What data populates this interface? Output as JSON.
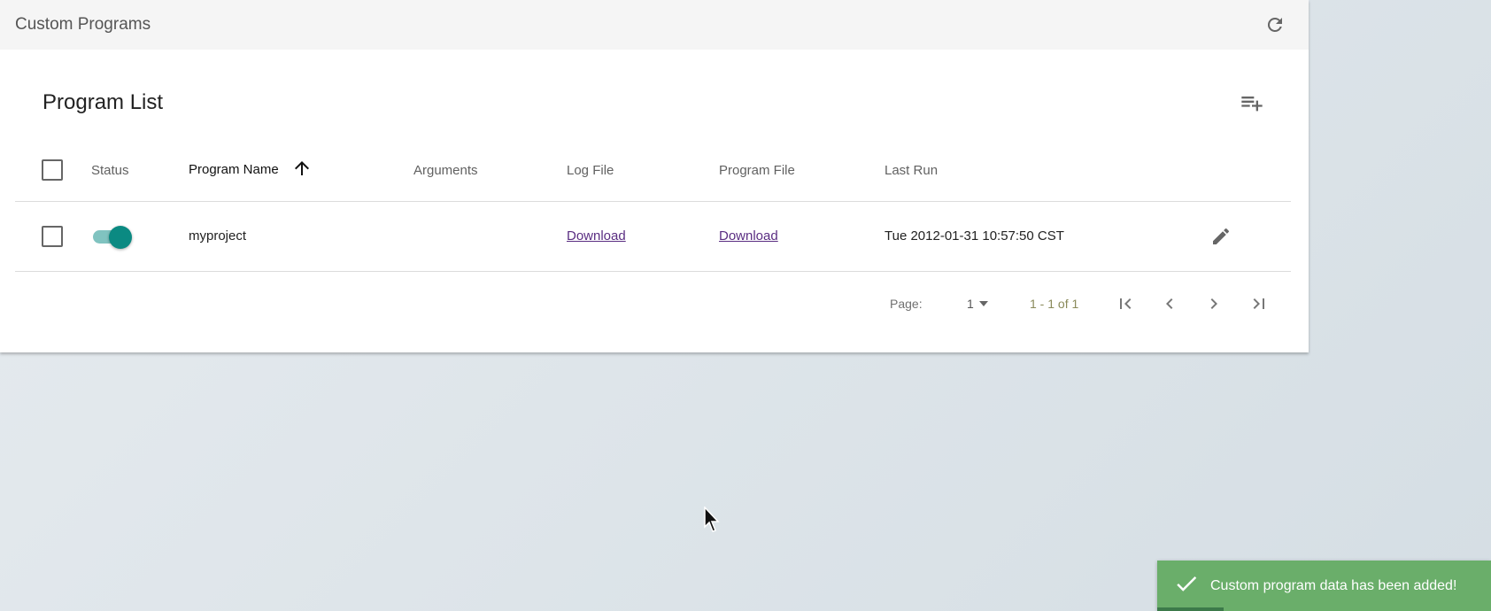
{
  "header": {
    "title": "Custom Programs",
    "refresh_icon": "refresh-icon"
  },
  "card": {
    "title": "Program List",
    "add_icon": "playlist-add-icon"
  },
  "table": {
    "columns": {
      "status": "Status",
      "name": "Program Name",
      "arguments": "Arguments",
      "log_file": "Log File",
      "program_file": "Program File",
      "last_run": "Last Run"
    },
    "sorted_column": "Program Name",
    "sort_direction": "ascending",
    "rows": [
      {
        "checked": false,
        "status_enabled": true,
        "name": "myproject",
        "arguments": "",
        "log_file": "Download",
        "program_file": "Download",
        "last_run": "Tue 2012-01-31 10:57:50 CST"
      }
    ]
  },
  "pagination": {
    "page_label": "Page:",
    "page_value": "1",
    "range": "1 - 1 of 1"
  },
  "toast": {
    "message": "Custom program data has been added!",
    "color": "#6aae6a",
    "progress": 0.2
  },
  "colors": {
    "accent": "#0b8a82",
    "link": "#5a2d82"
  }
}
